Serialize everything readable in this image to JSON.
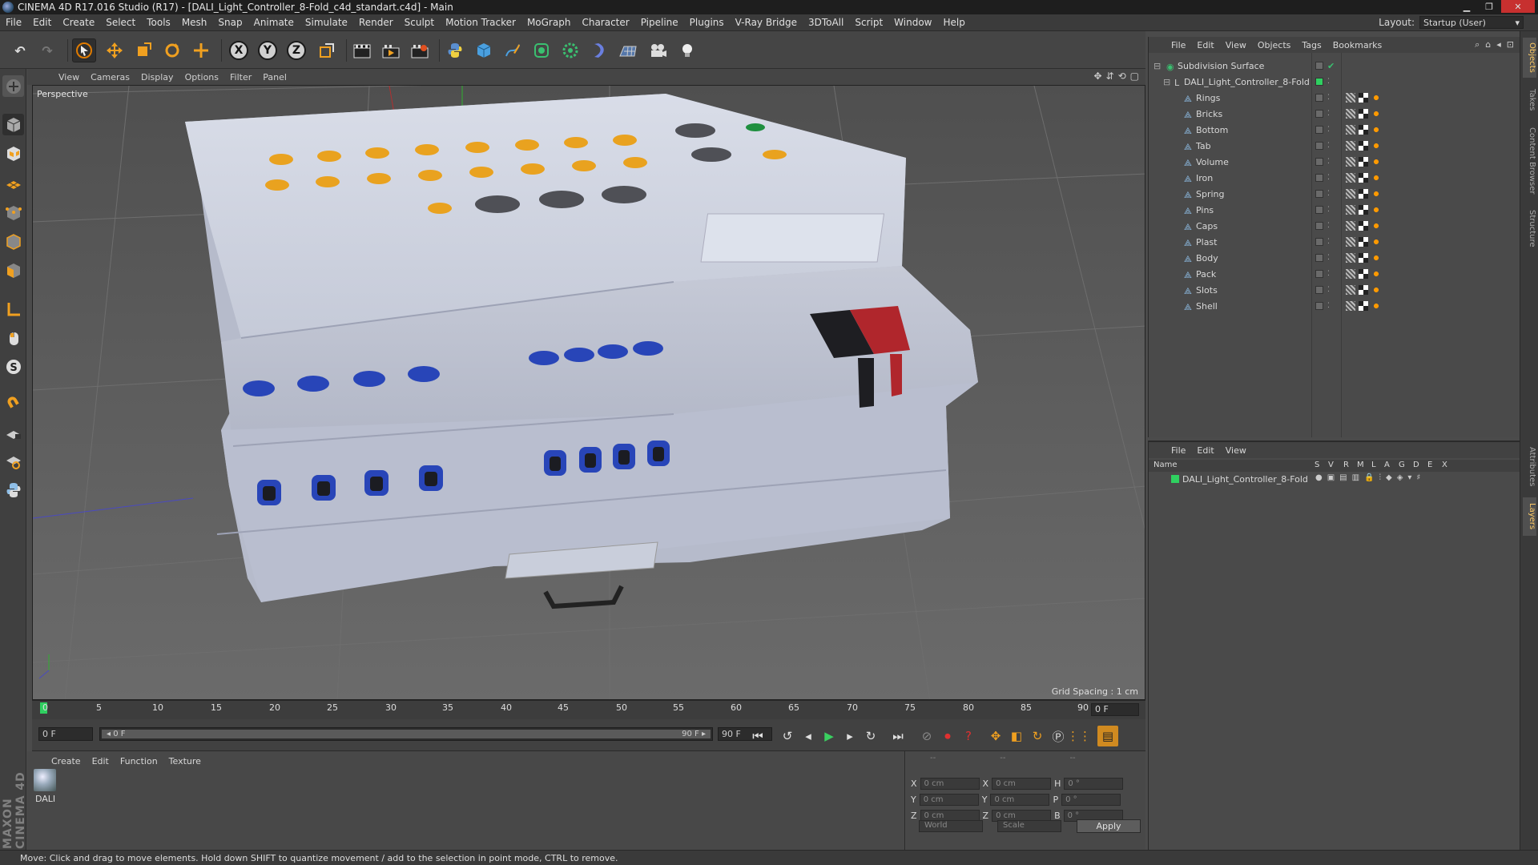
{
  "window": {
    "title": "CINEMA 4D R17.016 Studio (R17) - [DALI_Light_Controller_8-Fold_c4d_standart.c4d] - Main",
    "buttons": {
      "minimize": "▁",
      "maximize": "❐",
      "close": "✕"
    }
  },
  "menu": {
    "items": [
      "File",
      "Edit",
      "Create",
      "Select",
      "Tools",
      "Mesh",
      "Snap",
      "Animate",
      "Simulate",
      "Render",
      "Sculpt",
      "Motion Tracker",
      "MoGraph",
      "Character",
      "Pipeline",
      "Plugins",
      "V-Ray Bridge",
      "3DToAll",
      "Script",
      "Window",
      "Help"
    ],
    "layout_label": "Layout:",
    "layout_value": "Startup (User)"
  },
  "toolbar": {
    "axis_x": "X",
    "axis_y": "Y",
    "axis_z": "Z"
  },
  "viewport": {
    "menu": [
      "View",
      "Cameras",
      "Display",
      "Options",
      "Filter",
      "Panel"
    ],
    "camera_label": "Perspective",
    "grid_spacing": "Grid Spacing : 1 cm"
  },
  "timeline": {
    "ticks": [
      "0",
      "5",
      "10",
      "15",
      "20",
      "25",
      "30",
      "35",
      "40",
      "45",
      "50",
      "55",
      "60",
      "65",
      "70",
      "75",
      "80",
      "85",
      "90"
    ],
    "current_frame": "0 F",
    "start_field": "0 F",
    "range_start": "◂ 0 F",
    "range_end": "90 F ▸",
    "end_field": "90 F"
  },
  "material_panel": {
    "menu": [
      "Create",
      "Edit",
      "Function",
      "Texture"
    ],
    "material_name": "DALI"
  },
  "coords": {
    "header": [
      "--",
      "--",
      "--"
    ],
    "rows": [
      {
        "l1": "X",
        "v1": "0 cm",
        "l2": "X",
        "v2": "0 cm",
        "l3": "H",
        "v3": "0 °"
      },
      {
        "l1": "Y",
        "v1": "0 cm",
        "l2": "Y",
        "v2": "0 cm",
        "l3": "P",
        "v3": "0 °"
      },
      {
        "l1": "Z",
        "v1": "0 cm",
        "l2": "Z",
        "v2": "0 cm",
        "l3": "B",
        "v3": "0 °"
      }
    ],
    "mode": "World",
    "size_mode": "Scale",
    "apply": "Apply"
  },
  "object_manager": {
    "menu": [
      "File",
      "Edit",
      "View",
      "Objects",
      "Tags",
      "Bookmarks"
    ],
    "root": "Subdivision Surface",
    "group": "DALI_Light_Controller_8-Fold",
    "children": [
      "Rings",
      "Bricks",
      "Bottom",
      "Tab",
      "Volume",
      "Iron",
      "Spring",
      "Pins",
      "Caps",
      "Plast",
      "Body",
      "Pack",
      "Slots",
      "Shell"
    ]
  },
  "layer_manager": {
    "menu": [
      "File",
      "Edit",
      "View"
    ],
    "columns": [
      "Name",
      "S",
      "V",
      "R",
      "M",
      "L",
      "A",
      "G",
      "D",
      "E",
      "X"
    ],
    "layer": "DALI_Light_Controller_8-Fold"
  },
  "right_tabs": [
    "Objects",
    "Takes",
    "Content Browser",
    "Structure",
    "Attributes",
    "Layers"
  ],
  "status": "Move: Click and drag to move elements. Hold down SHIFT to quantize movement / add to the selection in point mode, CTRL to remove.",
  "branding": "MAXON CINEMA 4D"
}
